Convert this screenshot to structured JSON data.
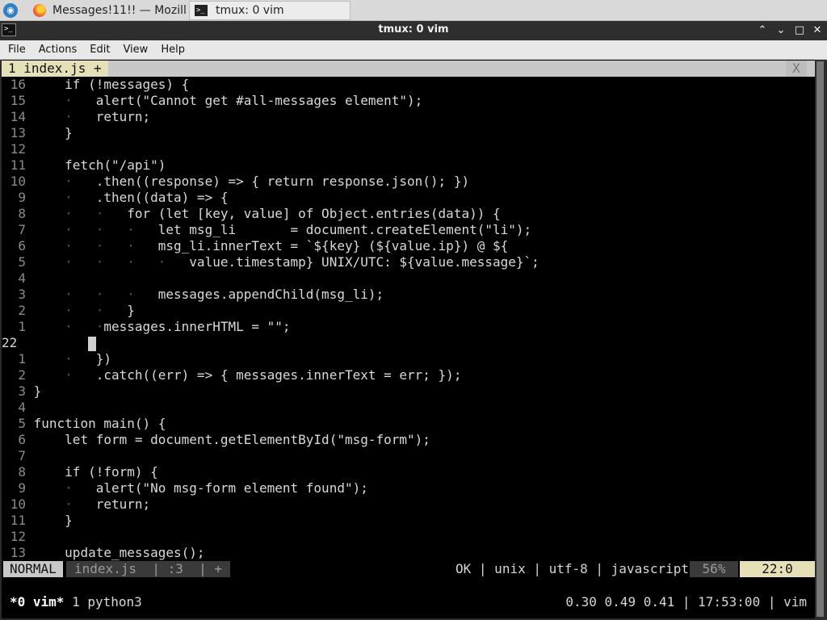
{
  "taskbar": {
    "tasks": [
      {
        "label": "Messages!11!! — Mozill...",
        "icon": "firefox-icon"
      },
      {
        "label": "tmux: 0 vim",
        "icon": "terminal-icon"
      }
    ]
  },
  "window": {
    "title": "tmux: 0 vim",
    "buttons": {
      "minimize": "⌃",
      "restore": "⌄",
      "maximize": "□",
      "close": "✕"
    }
  },
  "menubar": {
    "items": [
      "File",
      "Actions",
      "Edit",
      "View",
      "Help"
    ]
  },
  "vim": {
    "tabline": {
      "active_tab": "1 index.js +",
      "close_label": "X"
    },
    "lines": [
      {
        "n": "16",
        "indent": "    ",
        "code": "if (!messages) {"
      },
      {
        "n": "15",
        "indent": "    ·   ",
        "code": "alert(\"Cannot get #all-messages element\");"
      },
      {
        "n": "14",
        "indent": "    ·   ",
        "code": "return;"
      },
      {
        "n": "13",
        "indent": "    ",
        "code": "}"
      },
      {
        "n": "12",
        "indent": "",
        "code": ""
      },
      {
        "n": "11",
        "indent": "    ",
        "code": "fetch(\"/api\")"
      },
      {
        "n": "10",
        "indent": "    ·   ",
        "code": ".then((response) => { return response.json(); })"
      },
      {
        "n": "9",
        "indent": "    ·   ",
        "code": ".then((data) => {"
      },
      {
        "n": "8",
        "indent": "    ·   ·   ",
        "code": "for (let [key, value] of Object.entries(data)) {"
      },
      {
        "n": "7",
        "indent": "    ·   ·   ·   ",
        "code": "let msg_li       = document.createElement(\"li\");"
      },
      {
        "n": "6",
        "indent": "    ·   ·   ·   ",
        "code": "msg_li.innerText = `${key} (${value.ip}) @ ${"
      },
      {
        "n": "5",
        "indent": "    ·   ·   ·   ·   ",
        "code": "value.timestamp} UNIX/UTC: ${value.message}`;"
      },
      {
        "n": "4",
        "indent": "",
        "code": ""
      },
      {
        "n": "3",
        "indent": "    ·   ·   ·   ",
        "code": "messages.appendChild(msg_li);"
      },
      {
        "n": "2",
        "indent": "    ·   ·   ",
        "code": "}"
      },
      {
        "n": "1",
        "indent": "    ·   ·",
        "code": "messages.innerHTML = \"\";"
      },
      {
        "n": "22",
        "indent": "       ",
        "code": "",
        "current": true
      },
      {
        "n": "1",
        "indent": "    ·   ",
        "code": "})"
      },
      {
        "n": "2",
        "indent": "    ·   ",
        "code": ".catch((err) => { messages.innerText = err; });"
      },
      {
        "n": "3",
        "indent": "",
        "code": "}"
      },
      {
        "n": "4",
        "indent": "",
        "code": ""
      },
      {
        "n": "5",
        "indent": "",
        "code": "function main() {"
      },
      {
        "n": "6",
        "indent": "    ",
        "code": "let form = document.getElementById(\"msg-form\");"
      },
      {
        "n": "7",
        "indent": "",
        "code": ""
      },
      {
        "n": "8",
        "indent": "    ",
        "code": "if (!form) {"
      },
      {
        "n": "9",
        "indent": "    ·   ",
        "code": "alert(\"No msg-form element found\");"
      },
      {
        "n": "10",
        "indent": "    ·   ",
        "code": "return;"
      },
      {
        "n": "11",
        "indent": "    ",
        "code": "}"
      },
      {
        "n": "12",
        "indent": "",
        "code": ""
      },
      {
        "n": "13",
        "indent": "    ",
        "code": "update_messages();"
      }
    ],
    "statusline": {
      "mode": "NORMAL",
      "file": "index.js  | :3  | +",
      "right_info": "OK | unix | utf-8 | javascript",
      "percent": "56%",
      "position": "22:0"
    }
  },
  "tmux": {
    "left_active": "*0 vim*",
    "left_rest": " 1 python3",
    "right": "0.30 0.49 0.41 | 17:53:00 | vim"
  }
}
